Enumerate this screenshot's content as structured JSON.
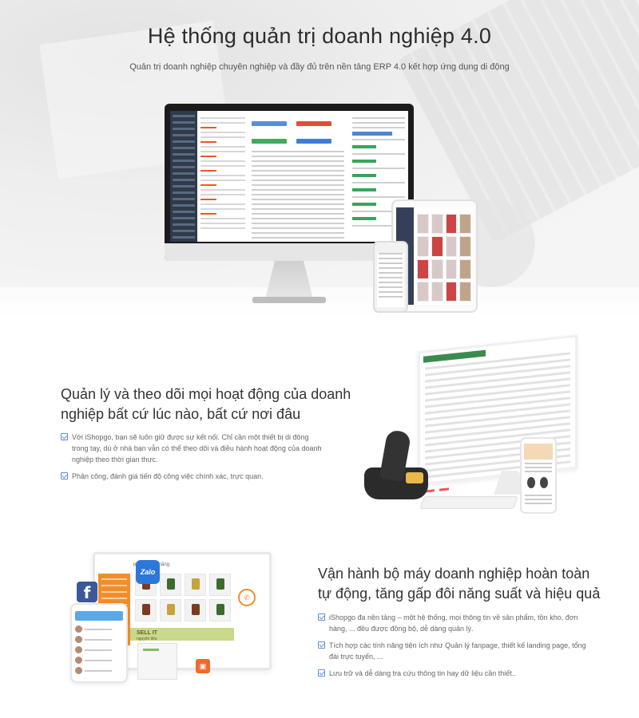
{
  "hero": {
    "title": "Hệ thống quản trị doanh nghiệp 4.0",
    "subtitle": "Quản trị doanh nghiệp chuyên nghiệp và đầy đủ trên nền tảng ERP 4.0 kết hợp ứng dụng di động"
  },
  "section_monitor": {
    "title": "Quản lý và theo dõi mọi hoạt động của doanh nghiệp bất cứ lúc nào, bất cứ nơi đâu",
    "bullets": [
      "Với iShopgo, bạn sẽ luôn giữ được sự kết nối. Chỉ cần một thiết bị di động trong tay, dù ở nhà bạn vẫn có thể theo dõi và điều hành hoạt động của doanh nghiệp theo thời gian thực.",
      "Phân công, đánh giá tiến độ công việc chính xác, trực quan."
    ]
  },
  "section_automation": {
    "title": "Vận hành bộ máy doanh nghiệp hoàn toàn tự động, tăng gấp đôi năng suất và hiệu quả",
    "bullets": [
      "iShopgo đa nền tảng – một hệ thống, mọi thông tin về sản phẩm, tồn kho, đơn hàng, ... đều được đồng bộ, dễ dàng quản lý.",
      "Tích hợp các tính năng tiện ích như Quản lý fanpage, thiết kế landing page, tổng đài trực tuyến, ...",
      "Lưu trữ và dễ dàng tra cứu thông tin hay dữ liệu cần thiết.."
    ]
  },
  "illustration": {
    "facebook_glyph": "f",
    "zalo_label": "Zalo",
    "banner_text": "SELL IT",
    "banner_sub": "nguyên liệu",
    "product_header": "phẩm chức năng"
  },
  "colors": {
    "check_accent": "#5b8fd6",
    "facebook": "#3b5998",
    "zalo": "#2b78d8",
    "orange": "#f28d2b"
  }
}
